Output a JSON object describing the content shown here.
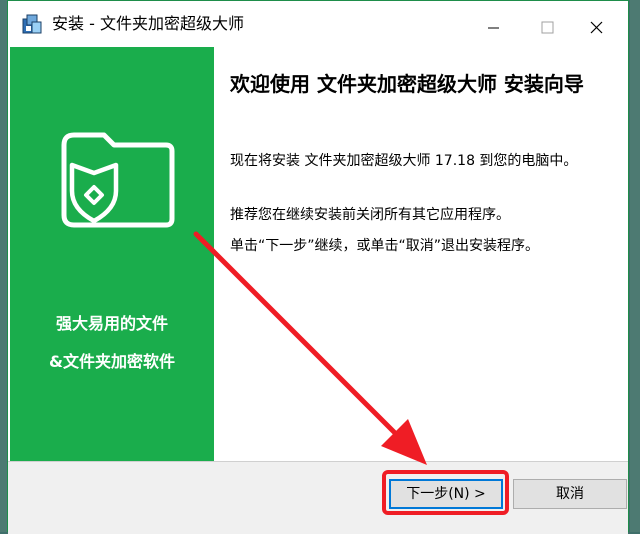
{
  "window": {
    "title": "安装 - 文件夹加密超级大师"
  },
  "banner": {
    "slogan_line1": "强大易用的文件",
    "slogan_line2": "&文件夹加密软件",
    "background_color": "#1aad4c"
  },
  "content": {
    "heading": "欢迎使用 文件夹加密超级大师 安装向导",
    "paragraph1": "现在将安装 文件夹加密超级大师 17.18 到您的电脑中。",
    "paragraph2": "推荐您在继续安装前关闭所有其它应用程序。",
    "paragraph3": "单击“下一步”继续，或单击“取消”退出安装程序。"
  },
  "buttons": {
    "next_label": "下一步(N) >",
    "cancel_label": "取消"
  },
  "annotation": {
    "arrow_color": "#ef1d25"
  },
  "icons": {
    "app": "installer-icon",
    "minimize": "minimize-icon",
    "maximize": "maximize-icon",
    "close": "close-icon",
    "banner": "folder-shield-icon"
  }
}
